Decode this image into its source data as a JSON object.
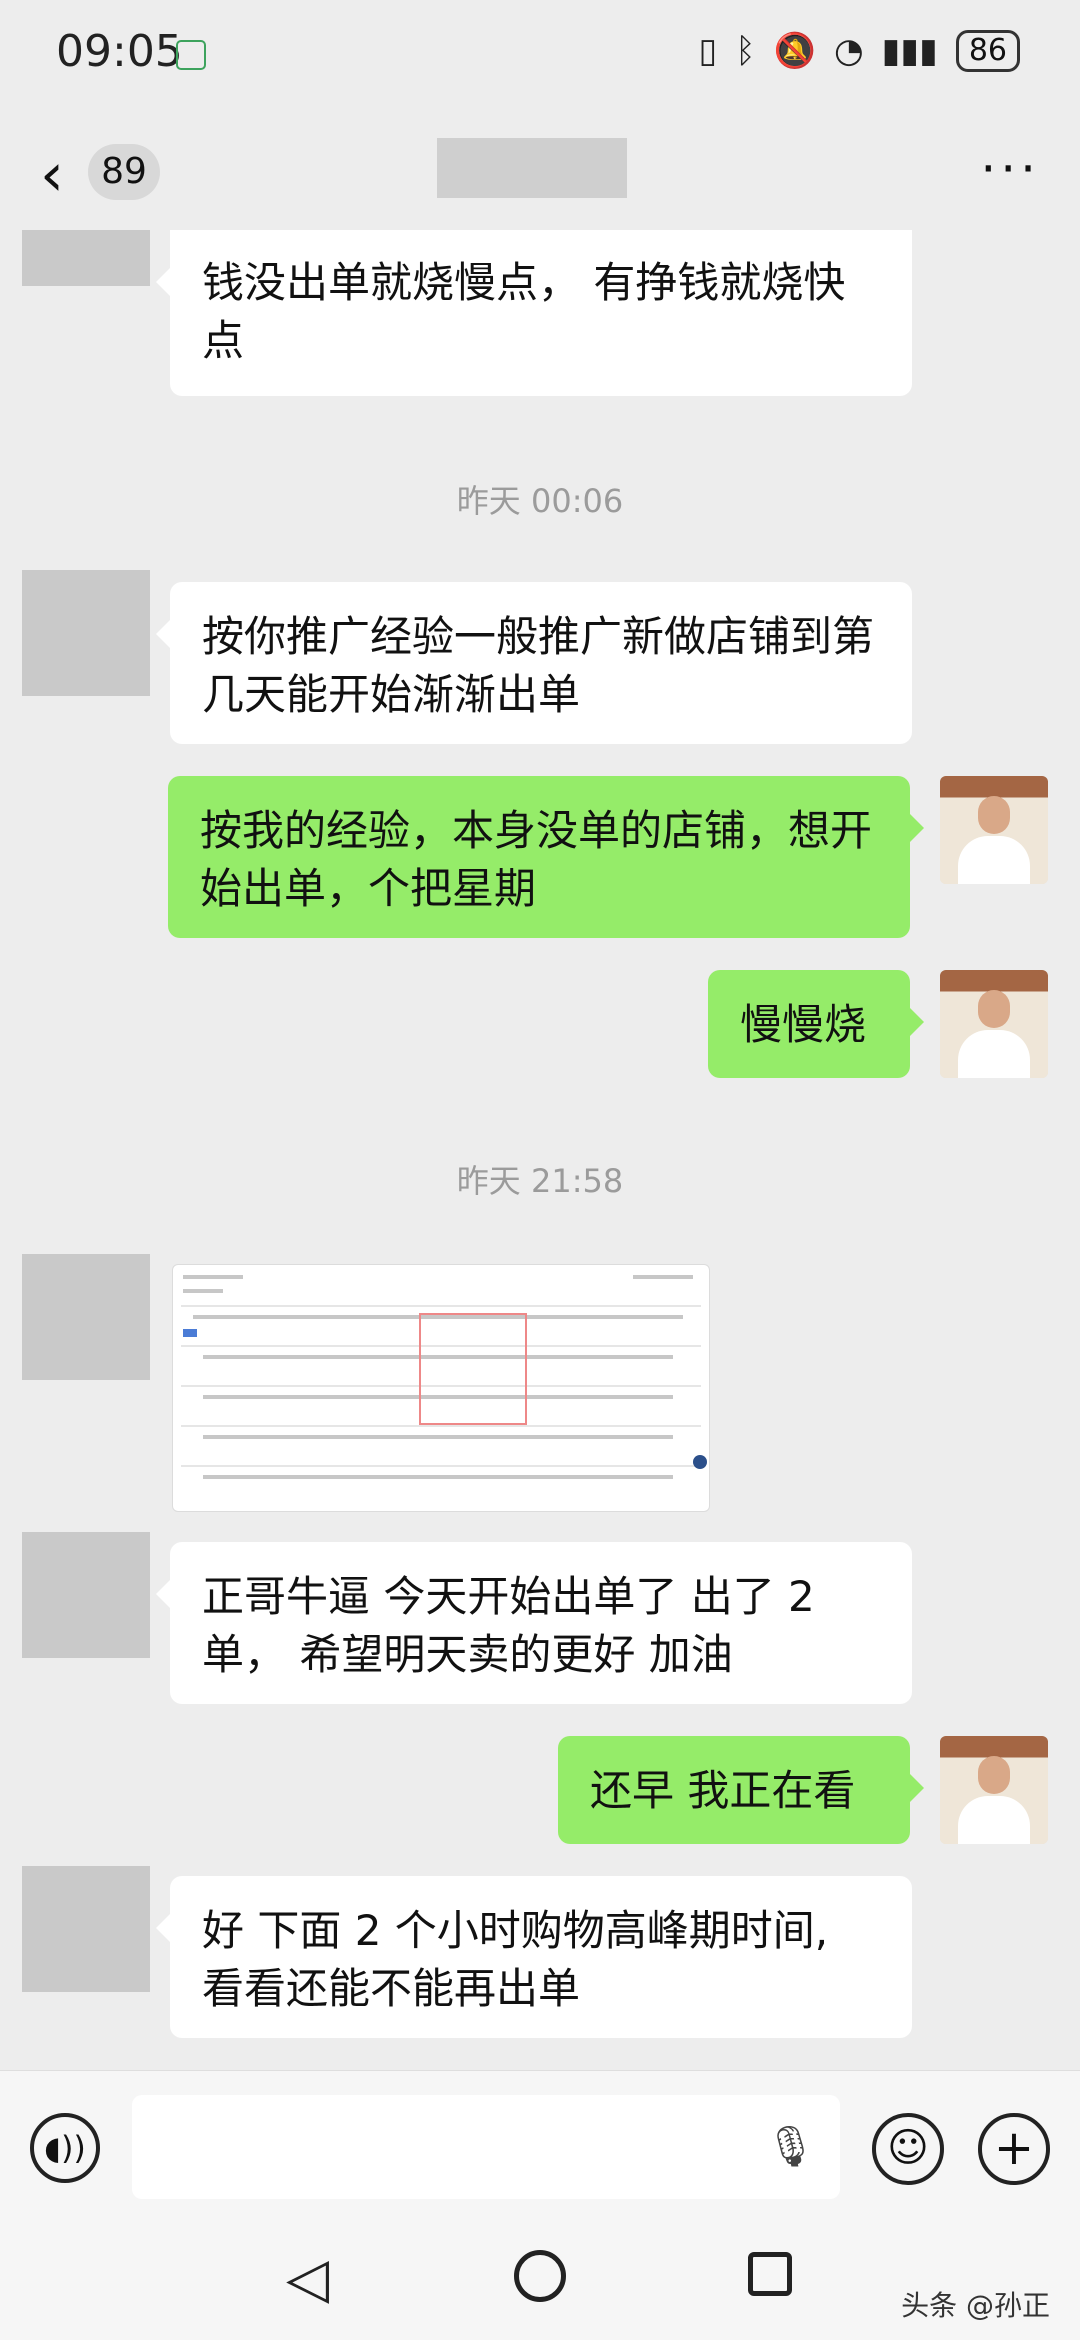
{
  "status_bar": {
    "time": "09:05",
    "battery": "86",
    "icons": [
      "nfc-icon",
      "bluetooth-icon",
      "mute-icon",
      "wifi-icon",
      "5g-signal-icon",
      "battery-icon"
    ]
  },
  "header": {
    "back_icon": "chevron-left-icon",
    "unread_count": "89",
    "more_icon": "more-dots-icon"
  },
  "messages": {
    "m1": "钱没出单就烧慢点， 有挣钱就烧快点",
    "t1": "昨天 00:06",
    "m2": "按你推广经验一般推广新做店铺到第几天能开始渐渐出单",
    "m3": "按我的经验，本身没单的店铺，想开始出单，个把星期",
    "m4": "慢慢烧",
    "t2": "昨天 21:58",
    "m5": "正哥牛逼 今天开始出单了 出了 2 单， 希望明天卖的更好 加油",
    "m6": "还早 我正在看",
    "m7": "好 下面 2 个小时购物高峰期时间, 看看还能不能再出单"
  },
  "input_bar": {
    "voice_icon": "voice-icon",
    "mic_icon": "mic-icon",
    "emoji_icon": "emoji-icon",
    "plus_icon": "plus-icon"
  },
  "nav_bar": {
    "watermark": "头条 @孙正"
  },
  "colors": {
    "background": "#ededed",
    "sent_bubble": "#95ec69",
    "received_bubble": "#ffffff"
  }
}
